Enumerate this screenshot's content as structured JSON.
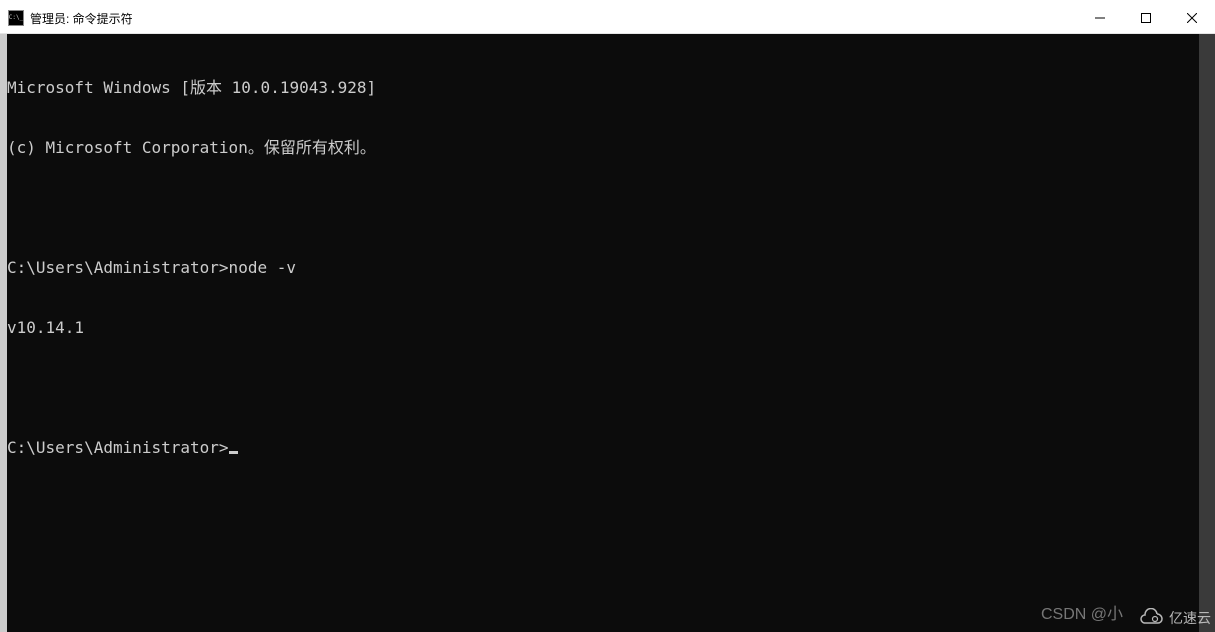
{
  "titlebar": {
    "title": "管理员: 命令提示符"
  },
  "terminal": {
    "lines": [
      "Microsoft Windows [版本 10.0.19043.928]",
      "(c) Microsoft Corporation。保留所有权利。",
      "",
      "C:\\Users\\Administrator>node -v",
      "v10.14.1",
      "",
      "C:\\Users\\Administrator>"
    ],
    "prompt_path": "C:\\Users\\Administrator",
    "node_version": "v10.14.1",
    "windows_version": "10.0.19043.928"
  },
  "watermarks": {
    "csdn": "CSDN @小",
    "cloud": "亿速云"
  }
}
